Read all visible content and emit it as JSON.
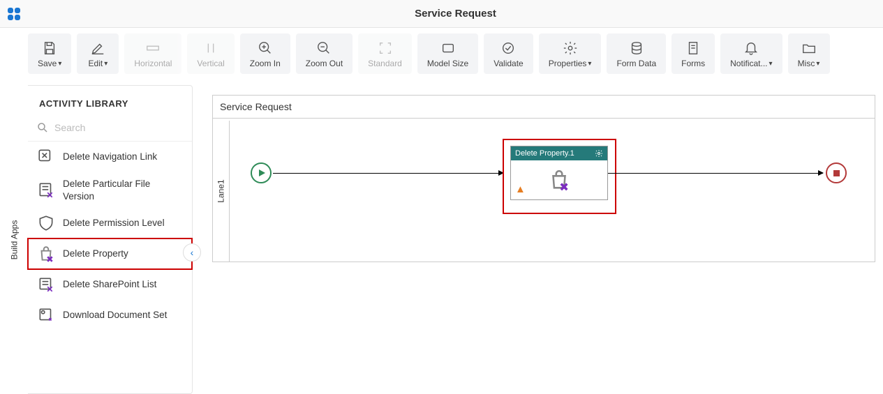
{
  "header": {
    "title": "Service Request"
  },
  "toolbar": {
    "save": "Save",
    "edit": "Edit",
    "horizontal": "Horizontal",
    "vertical": "Vertical",
    "zoom_in": "Zoom In",
    "zoom_out": "Zoom Out",
    "standard": "Standard",
    "model_size": "Model Size",
    "validate": "Validate",
    "properties": "Properties",
    "form_data": "Form Data",
    "forms": "Forms",
    "notifications": "Notificat...",
    "misc": "Misc"
  },
  "left_rail": "Build Apps",
  "sidebar": {
    "title": "ACTIVITY LIBRARY",
    "search_placeholder": "Search",
    "items": [
      {
        "label": "Delete Navigation Link"
      },
      {
        "label": "Delete Particular File Version"
      },
      {
        "label": "Delete Permission Level"
      },
      {
        "label": "Delete Property"
      },
      {
        "label": "Delete SharePoint List"
      },
      {
        "label": "Download Document Set"
      }
    ]
  },
  "canvas": {
    "process_name": "Service Request",
    "lane": "Lane1",
    "activity": {
      "title": "Delete Property.1"
    }
  }
}
